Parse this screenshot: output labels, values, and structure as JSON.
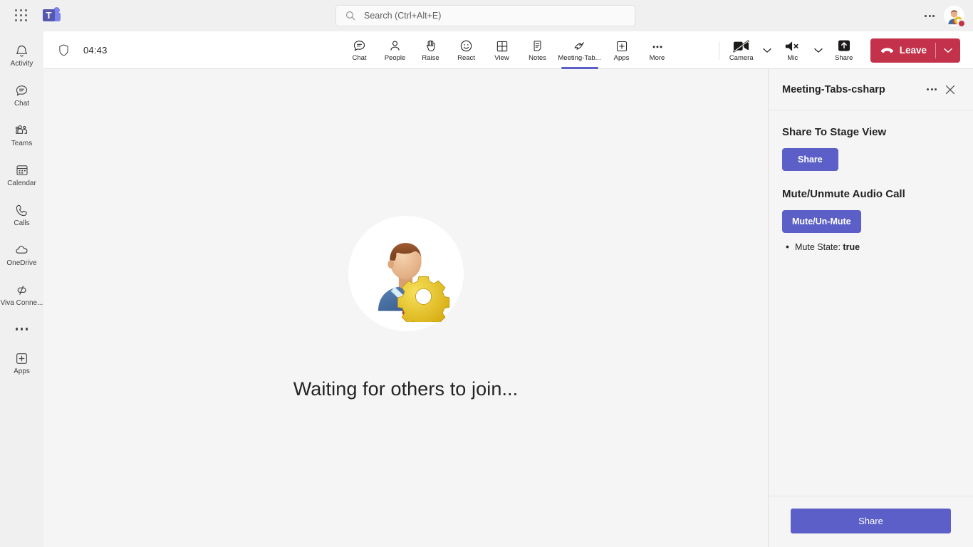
{
  "topbar": {
    "waffle_label": "app-launcher",
    "logo_letter": "T",
    "search_placeholder": "Search (Ctrl+Alt+E)",
    "ellipsis_label": "settings-and-more",
    "presence_color": "#c4314b"
  },
  "sidebar": {
    "items": [
      {
        "label": "Activity",
        "icon": "bell-icon"
      },
      {
        "label": "Chat",
        "icon": "chat-icon"
      },
      {
        "label": "Teams",
        "icon": "teams-icon"
      },
      {
        "label": "Calendar",
        "icon": "calendar-icon"
      },
      {
        "label": "Calls",
        "icon": "phone-icon"
      },
      {
        "label": "OneDrive",
        "icon": "cloud-icon"
      },
      {
        "label": "Viva Conne...",
        "icon": "viva-connections-icon"
      }
    ],
    "more_label": "more-apps",
    "apps_label": "Apps"
  },
  "meetbar": {
    "shield_icon": "shield-icon",
    "timer": "04:43",
    "controls": [
      {
        "label": "Chat",
        "icon": "chat-icon",
        "active": false
      },
      {
        "label": "People",
        "icon": "people-icon",
        "active": false
      },
      {
        "label": "Raise",
        "icon": "raise-hand-icon",
        "active": false
      },
      {
        "label": "React",
        "icon": "react-smiley-icon",
        "active": false
      },
      {
        "label": "View",
        "icon": "view-grid-icon",
        "active": false
      },
      {
        "label": "Notes",
        "icon": "notes-icon",
        "active": false
      },
      {
        "label": "Meeting-Tab...",
        "icon": "meeting-tab-app-icon",
        "active": true
      },
      {
        "label": "Apps",
        "icon": "apps-plus-icon",
        "active": false
      },
      {
        "label": "More",
        "icon": "more-ellipsis-icon",
        "active": false
      }
    ],
    "camera_label": "Camera",
    "camera_state": "off",
    "mic_label": "Mic",
    "mic_state": "muted",
    "share_label": "Share",
    "leave_label": "Leave",
    "leave_color": "#c4314b"
  },
  "stage": {
    "avatar_alt": "user-with-gear-avatar",
    "waiting_text": "Waiting for others to join..."
  },
  "panel": {
    "title": "Meeting-Tabs-csharp",
    "more_label": "panel-more-options",
    "close_label": "close-panel",
    "section_one_heading": "Share To Stage View",
    "share_button": "Share",
    "section_two_heading": "Mute/Unmute Audio Call",
    "mute_button": "Mute/Un-Mute",
    "mute_state_label": "Mute State:",
    "mute_state_value": "true",
    "footer_share_button": "Share",
    "accent_color": "#5b5fc7"
  }
}
